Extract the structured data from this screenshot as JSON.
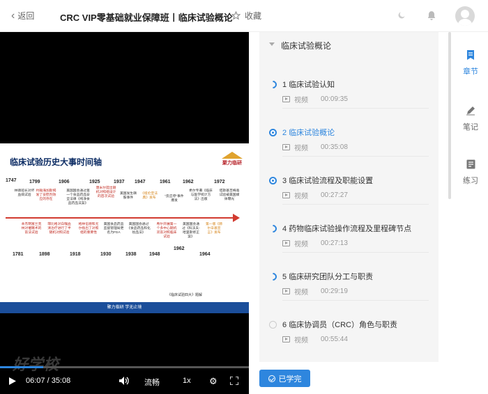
{
  "header": {
    "back_label": "返回",
    "course_title": "CRC VIP零基础就业保障班丨临床试验概论",
    "collect_label": "收藏",
    "icons": [
      "chevron-left-icon",
      "star-icon",
      "moon-icon",
      "bell-icon",
      "avatar"
    ]
  },
  "slide": {
    "title": "临床试验历史大事时间轴",
    "logo_text": "聚力临研",
    "footer": "聚力临研 学无止境",
    "source": "《临床试验四大》题解",
    "top_years": [
      "1747",
      "1799",
      "1906",
      "1925",
      "1937",
      "1947",
      "1961",
      "1962",
      "1972"
    ],
    "bottom_years": [
      "1781",
      "1898",
      "1918",
      "1930",
      "1938",
      "1948",
      "1962",
      "1964"
    ],
    "top_events": [
      {
        "text": "林德船长对坏血病试验",
        "style": "normal"
      },
      {
        "text": "约翰海加斯揭发了安慰剂效应的存在",
        "style": "hl"
      },
      {
        "text": "美国国会通过第一个食品药品安全法律《纯净食品药品法案》",
        "style": "normal"
      },
      {
        "text": "唐米尔提出随机对照组设计的首次试验",
        "style": "hl"
      },
      {
        "text": "美国发生磺胺事件",
        "style": "normal"
      },
      {
        "text": "《纽伦堡法典》发布",
        "style": "or"
      },
      {
        "text": "“反应停”事件爆发",
        "style": "normal"
      },
      {
        "text": "希尔专著《临床与医学统计方法》出版",
        "style": "normal"
      },
      {
        "text": "塔斯基吉梅毒试验被美国媒体曝光",
        "style": "normal"
      }
    ],
    "bottom_events": [
      {
        "text": "本杰明富兰克林对催眠术的盲法试验",
        "style": "hl"
      },
      {
        "text": "菲比格对白喉血清治疗进行了半随机对照试验",
        "style": "hl"
      },
      {
        "text": "格林伍德和尤尔指出了对照组的重要性",
        "style": "hl"
      },
      {
        "text": "美国食品药品监督管理局更名为FDA",
        "style": "normal"
      },
      {
        "text": "美国国会通过《食品药品和化妆品法》",
        "style": "normal"
      },
      {
        "text": "希尔开展第一个多中心随机双盲对照临床试验",
        "style": "hl"
      },
      {
        "text": "美国国会通过《科沃夫-哈里斯修正案》",
        "style": "normal"
      },
      {
        "text": "第一版《赫尔辛基宣言》发布",
        "style": "or"
      }
    ]
  },
  "player": {
    "watermark": "好学校",
    "time": "06:07 / 35:08",
    "progress": 0.174,
    "quality": "流畅",
    "speed": "1x"
  },
  "chapter": {
    "header_label": "临床试验概论",
    "lessons": [
      {
        "title": "1 临床试验认知",
        "type": "视频",
        "duration": "00:09:35",
        "state": "half"
      },
      {
        "title": "2 临床试验概论",
        "type": "视频",
        "duration": "00:35:08",
        "state": "active"
      },
      {
        "title": "3 临床试验流程及职能设置",
        "type": "视频",
        "duration": "00:27:27",
        "state": "active"
      },
      {
        "title": "4 药物临床试验操作流程及里程碑节点",
        "type": "视频",
        "duration": "00:27:13",
        "state": "half"
      },
      {
        "title": "5 临床研究团队分工与职责",
        "type": "视频",
        "duration": "00:29:19",
        "state": "half"
      },
      {
        "title": "6 临床协调员（CRC）角色与职责",
        "type": "视频",
        "duration": "00:55:44",
        "state": "empty"
      }
    ]
  },
  "done_button": {
    "label": "已学完"
  },
  "sidebar": {
    "items": [
      {
        "label": "章节",
        "icon": "bookmark-icon",
        "active": true
      },
      {
        "label": "笔记",
        "icon": "pencil-icon",
        "active": false
      },
      {
        "label": "练习",
        "icon": "exercise-icon",
        "active": false
      }
    ]
  },
  "colors": {
    "accent": "#2e86de",
    "timeline": "#d23b30",
    "slide_footer": "#1b4e9a"
  }
}
